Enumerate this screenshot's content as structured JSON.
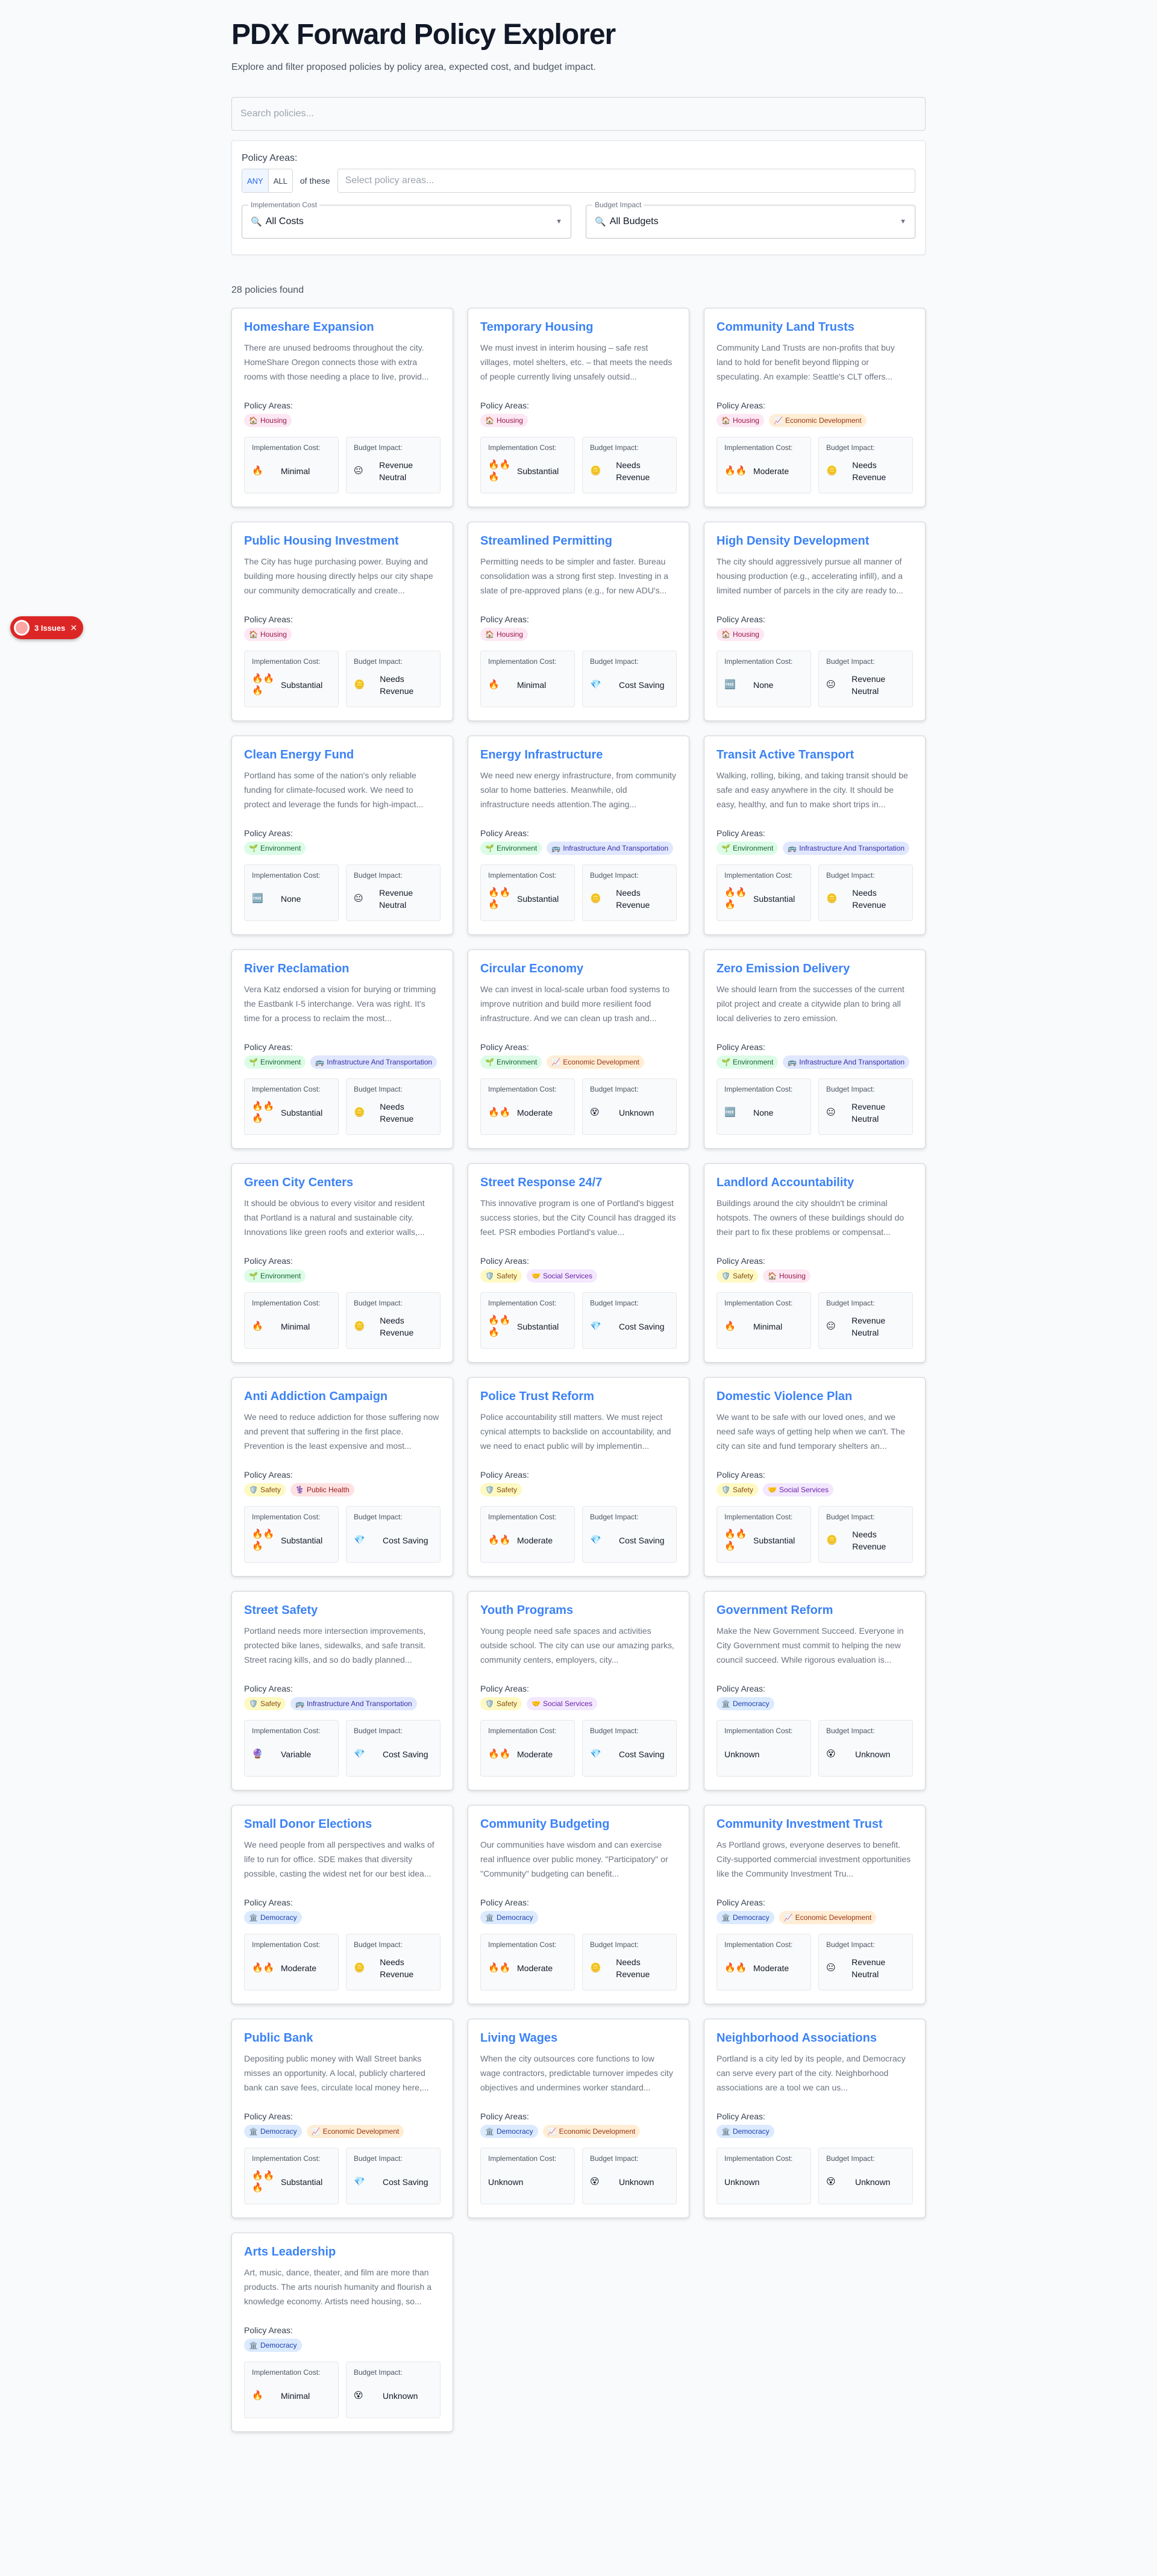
{
  "header": {
    "title": "PDX Forward Policy Explorer",
    "subtitle": "Explore and filter proposed policies by policy area, expected cost, and budget impact."
  },
  "search": {
    "placeholder": "Search policies..."
  },
  "filters": {
    "policy_areas_label": "Policy Areas:",
    "any_label": "ANY",
    "all_label": "ALL",
    "of_these": "of these",
    "areas_placeholder": "Select policy areas...",
    "cost_label": "Implementation Cost",
    "cost_value": "All Costs",
    "budget_label": "Budget Impact",
    "budget_value": "All Budgets"
  },
  "results_count": "28 policies found",
  "issues_badge": {
    "label": "3 Issues"
  },
  "card_labels": {
    "policy_areas": "Policy Areas:",
    "cost": "Implementation Cost:",
    "budget": "Budget Impact:"
  },
  "policies": [
    {
      "title": "Homeshare Expansion",
      "desc": "There are unused bedrooms throughout the city. HomeShare Oregon connects those with extra rooms with those needing a place to live, provid...",
      "tags": [
        {
          "label": "Housing",
          "cls": "housing",
          "icon": "🏠"
        }
      ],
      "cost_icon": "🔥",
      "cost": "Minimal",
      "budget_icon": "😐",
      "budget": "Revenue Neutral"
    },
    {
      "title": "Temporary Housing",
      "desc": "We must invest in interim housing – safe rest villages, motel shelters, etc. – that meets the needs of people currently living unsafely outsid...",
      "tags": [
        {
          "label": "Housing",
          "cls": "housing",
          "icon": "🏠"
        }
      ],
      "cost_icon": "🔥🔥🔥",
      "cost": "Substantial",
      "budget_icon": "🪙",
      "budget": "Needs Revenue"
    },
    {
      "title": "Community Land Trusts",
      "desc": "Community Land Trusts are non-profits that buy land to hold for benefit beyond flipping or speculating. An example: Seattle's CLT offers...",
      "tags": [
        {
          "label": "Housing",
          "cls": "housing",
          "icon": "🏠"
        },
        {
          "label": "Economic Development",
          "cls": "econ",
          "icon": "📈"
        }
      ],
      "cost_icon": "🔥🔥",
      "cost": "Moderate",
      "budget_icon": "🪙",
      "budget": "Needs Revenue"
    },
    {
      "title": "Public Housing Investment",
      "desc": "The City has huge purchasing power. Buying and building more housing directly helps our city shape our community democratically and create...",
      "tags": [
        {
          "label": "Housing",
          "cls": "housing",
          "icon": "🏠"
        }
      ],
      "cost_icon": "🔥🔥🔥",
      "cost": "Substantial",
      "budget_icon": "🪙",
      "budget": "Needs Revenue"
    },
    {
      "title": "Streamlined Permitting",
      "desc": "Permitting needs to be simpler and faster. Bureau consolidation was a strong first step. Investing in a slate of pre-approved plans (e.g., for new ADU's...",
      "tags": [
        {
          "label": "Housing",
          "cls": "housing",
          "icon": "🏠"
        }
      ],
      "cost_icon": "🔥",
      "cost": "Minimal",
      "budget_icon": "💎",
      "budget": "Cost Saving"
    },
    {
      "title": "High Density Development",
      "desc": "The city should aggressively pursue all manner of housing production (e.g., accelerating infill), and a limited number of parcels in the city are ready to...",
      "tags": [
        {
          "label": "Housing",
          "cls": "housing",
          "icon": "🏠"
        }
      ],
      "cost_icon": "🆓",
      "cost": "None",
      "budget_icon": "😐",
      "budget": "Revenue Neutral"
    },
    {
      "title": "Clean Energy Fund",
      "desc": "Portland has some of the nation's only reliable funding for climate-focused work. We need to protect and leverage the funds for high-impact...",
      "tags": [
        {
          "label": "Environment",
          "cls": "env",
          "icon": "🌱"
        }
      ],
      "cost_icon": "🆓",
      "cost": "None",
      "budget_icon": "😐",
      "budget": "Revenue Neutral"
    },
    {
      "title": "Energy Infrastructure",
      "desc": "We need new energy infrastructure, from community solar to home batteries. Meanwhile, old infrastructure needs attention.The aging...",
      "tags": [
        {
          "label": "Environment",
          "cls": "env",
          "icon": "🌱"
        },
        {
          "label": "Infrastructure And Transportation",
          "cls": "infra",
          "icon": "🚌"
        }
      ],
      "cost_icon": "🔥🔥🔥",
      "cost": "Substantial",
      "budget_icon": "🪙",
      "budget": "Needs Revenue"
    },
    {
      "title": "Transit Active Transport",
      "desc": "Walking, rolling, biking, and taking transit should be safe and easy anywhere in the city. It should be easy, healthy, and fun to make short trips in...",
      "tags": [
        {
          "label": "Environment",
          "cls": "env",
          "icon": "🌱"
        },
        {
          "label": "Infrastructure And Transportation",
          "cls": "infra",
          "icon": "🚌"
        }
      ],
      "cost_icon": "🔥🔥🔥",
      "cost": "Substantial",
      "budget_icon": "🪙",
      "budget": "Needs Revenue"
    },
    {
      "title": "River Reclamation",
      "desc": "Vera Katz endorsed a vision for burying or trimming the Eastbank I-5 interchange. Vera was right. It's time for a process to reclaim the most...",
      "tags": [
        {
          "label": "Environment",
          "cls": "env",
          "icon": "🌱"
        },
        {
          "label": "Infrastructure And Transportation",
          "cls": "infra",
          "icon": "🚌"
        }
      ],
      "cost_icon": "🔥🔥🔥",
      "cost": "Substantial",
      "budget_icon": "🪙",
      "budget": "Needs Revenue"
    },
    {
      "title": "Circular Economy",
      "desc": "We can invest in local-scale urban food systems to improve nutrition and build more resilient food infrastructure. And we can clean up trash and...",
      "tags": [
        {
          "label": "Environment",
          "cls": "env",
          "icon": "🌱"
        },
        {
          "label": "Economic Development",
          "cls": "econ",
          "icon": "📈"
        }
      ],
      "cost_icon": "🔥🔥",
      "cost": "Moderate",
      "budget_icon": "😵",
      "budget": "Unknown"
    },
    {
      "title": "Zero Emission Delivery",
      "desc": "We should learn from the successes of the current pilot project and create a citywide plan to bring all local deliveries to zero emission.",
      "tags": [
        {
          "label": "Environment",
          "cls": "env",
          "icon": "🌱"
        },
        {
          "label": "Infrastructure And Transportation",
          "cls": "infra",
          "icon": "🚌"
        }
      ],
      "cost_icon": "🆓",
      "cost": "None",
      "budget_icon": "😐",
      "budget": "Revenue Neutral"
    },
    {
      "title": "Green City Centers",
      "desc": "It should be obvious to every visitor and resident that Portland is a natural and sustainable city. Innovations like green roofs and exterior walls,...",
      "tags": [
        {
          "label": "Environment",
          "cls": "env",
          "icon": "🌱"
        }
      ],
      "cost_icon": "🔥",
      "cost": "Minimal",
      "budget_icon": "🪙",
      "budget": "Needs Revenue"
    },
    {
      "title": "Street Response 24/7",
      "desc": "This innovative program is one of Portland's biggest success stories, but the City Council has dragged its feet. PSR embodies Portland's value...",
      "tags": [
        {
          "label": "Safety",
          "cls": "safety",
          "icon": "🛡️"
        },
        {
          "label": "Social Services",
          "cls": "social",
          "icon": "🤝"
        }
      ],
      "cost_icon": "🔥🔥🔥",
      "cost": "Substantial",
      "budget_icon": "💎",
      "budget": "Cost Saving"
    },
    {
      "title": "Landlord Accountability",
      "desc": "Buildings around the city shouldn't be criminal hotspots. The owners of these buildings should do their part to fix these problems or compensat...",
      "tags": [
        {
          "label": "Safety",
          "cls": "safety",
          "icon": "🛡️"
        },
        {
          "label": "Housing",
          "cls": "housing",
          "icon": "🏠"
        }
      ],
      "cost_icon": "🔥",
      "cost": "Minimal",
      "budget_icon": "😐",
      "budget": "Revenue Neutral"
    },
    {
      "title": "Anti Addiction Campaign",
      "desc": "We need to reduce addiction for those suffering now and prevent that suffering in the first place. Prevention is the least expensive and most...",
      "tags": [
        {
          "label": "Safety",
          "cls": "safety",
          "icon": "🛡️"
        },
        {
          "label": "Public Health",
          "cls": "health",
          "icon": "⚕️"
        }
      ],
      "cost_icon": "🔥🔥🔥",
      "cost": "Substantial",
      "budget_icon": "💎",
      "budget": "Cost Saving"
    },
    {
      "title": "Police Trust Reform",
      "desc": "Police accountability still matters. We must reject cynical attempts to backslide on accountability, and we need to enact public will by implementin...",
      "tags": [
        {
          "label": "Safety",
          "cls": "safety",
          "icon": "🛡️"
        }
      ],
      "cost_icon": "🔥🔥",
      "cost": "Moderate",
      "budget_icon": "💎",
      "budget": "Cost Saving"
    },
    {
      "title": "Domestic Violence Plan",
      "desc": "We want to be safe with our loved ones, and we need safe ways of getting help when we can't. The city can site and fund temporary shelters an...",
      "tags": [
        {
          "label": "Safety",
          "cls": "safety",
          "icon": "🛡️"
        },
        {
          "label": "Social Services",
          "cls": "social",
          "icon": "🤝"
        }
      ],
      "cost_icon": "🔥🔥🔥",
      "cost": "Substantial",
      "budget_icon": "🪙",
      "budget": "Needs Revenue"
    },
    {
      "title": "Street Safety",
      "desc": "Portland needs more intersection improvements, protected bike lanes, sidewalks, and safe transit. Street racing kills, and so do badly planned...",
      "tags": [
        {
          "label": "Safety",
          "cls": "safety",
          "icon": "🛡️"
        },
        {
          "label": "Infrastructure And Transportation",
          "cls": "infra",
          "icon": "🚌"
        }
      ],
      "cost_icon": "🔮",
      "cost": "Variable",
      "budget_icon": "💎",
      "budget": "Cost Saving"
    },
    {
      "title": "Youth Programs",
      "desc": "Young people need safe spaces and activities outside school. The city can use our amazing parks, community centers, employers, city...",
      "tags": [
        {
          "label": "Safety",
          "cls": "safety",
          "icon": "🛡️"
        },
        {
          "label": "Social Services",
          "cls": "social",
          "icon": "🤝"
        }
      ],
      "cost_icon": "🔥🔥",
      "cost": "Moderate",
      "budget_icon": "💎",
      "budget": "Cost Saving"
    },
    {
      "title": "Government Reform",
      "desc": "Make the New Government Succeed. Everyone in City Government must commit to helping the new council succeed. While rigorous evaluation is...",
      "tags": [
        {
          "label": "Democracy",
          "cls": "democ",
          "icon": "🏛️"
        }
      ],
      "cost_icon": "",
      "cost": "Unknown",
      "budget_icon": "😵",
      "budget": "Unknown"
    },
    {
      "title": "Small Donor Elections",
      "desc": "We need people from all perspectives and walks of life to run for office. SDE makes that diversity possible, casting the widest net for our best idea...",
      "tags": [
        {
          "label": "Democracy",
          "cls": "democ",
          "icon": "🏛️"
        }
      ],
      "cost_icon": "🔥🔥",
      "cost": "Moderate",
      "budget_icon": "🪙",
      "budget": "Needs Revenue"
    },
    {
      "title": "Community Budgeting",
      "desc": "Our communities have wisdom and can exercise real influence over public money. \"Participatory\" or \"Community\" budgeting can benefit...",
      "tags": [
        {
          "label": "Democracy",
          "cls": "democ",
          "icon": "🏛️"
        }
      ],
      "cost_icon": "🔥🔥",
      "cost": "Moderate",
      "budget_icon": "🪙",
      "budget": "Needs Revenue"
    },
    {
      "title": "Community Investment Trust",
      "desc": "As Portland grows, everyone deserves to benefit. City-supported commercial investment opportunities like the Community Investment Tru...",
      "tags": [
        {
          "label": "Democracy",
          "cls": "democ",
          "icon": "🏛️"
        },
        {
          "label": "Economic Development",
          "cls": "econ",
          "icon": "📈"
        }
      ],
      "cost_icon": "🔥🔥",
      "cost": "Moderate",
      "budget_icon": "😐",
      "budget": "Revenue Neutral"
    },
    {
      "title": "Public Bank",
      "desc": "Depositing public money with Wall Street banks misses an opportunity. A local, publicly chartered bank can save fees, circulate local money here,...",
      "tags": [
        {
          "label": "Democracy",
          "cls": "democ",
          "icon": "🏛️"
        },
        {
          "label": "Economic Development",
          "cls": "econ",
          "icon": "📈"
        }
      ],
      "cost_icon": "🔥🔥🔥",
      "cost": "Substantial",
      "budget_icon": "💎",
      "budget": "Cost Saving"
    },
    {
      "title": "Living Wages",
      "desc": "When the city outsources core functions to low wage contractors, predictable turnover impedes city objectives and undermines worker standard...",
      "tags": [
        {
          "label": "Democracy",
          "cls": "democ",
          "icon": "🏛️"
        },
        {
          "label": "Economic Development",
          "cls": "econ",
          "icon": "📈"
        }
      ],
      "cost_icon": "",
      "cost": "Unknown",
      "budget_icon": "😵",
      "budget": "Unknown"
    },
    {
      "title": "Neighborhood Associations",
      "desc": "Portland is a city led by its people, and Democracy can serve every part of the city. Neighborhood associations are a tool we can us...",
      "tags": [
        {
          "label": "Democracy",
          "cls": "democ",
          "icon": "🏛️"
        }
      ],
      "cost_icon": "",
      "cost": "Unknown",
      "budget_icon": "😵",
      "budget": "Unknown"
    },
    {
      "title": "Arts Leadership",
      "desc": "Art, music, dance, theater, and film are more than products. The arts nourish humanity and flourish a knowledge economy. Artists need housing, so...",
      "tags": [
        {
          "label": "Democracy",
          "cls": "democ",
          "icon": "🏛️"
        }
      ],
      "cost_icon": "🔥",
      "cost": "Minimal",
      "budget_icon": "😵",
      "budget": "Unknown"
    }
  ]
}
